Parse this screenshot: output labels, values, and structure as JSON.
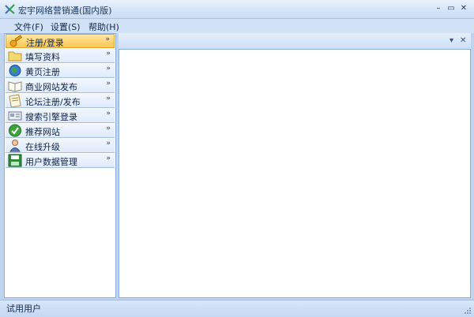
{
  "window": {
    "title": "宏宇网络营销通(国内版)",
    "minimize": "–",
    "restore": "▭",
    "close": "✕"
  },
  "menu": [
    {
      "label": "文件(F)"
    },
    {
      "label": "设置(S)"
    },
    {
      "label": "帮助(H)"
    }
  ],
  "sidebar": {
    "items": [
      {
        "label": "注册/登录",
        "icon": "key-icon",
        "active": true
      },
      {
        "label": "填写资料",
        "icon": "folder-icon"
      },
      {
        "label": "黄页注册",
        "icon": "globe-icon"
      },
      {
        "label": "商业网站发布",
        "icon": "book-icon"
      },
      {
        "label": "论坛注册/发布",
        "icon": "note-icon"
      },
      {
        "label": "搜索引擎登录",
        "icon": "card-icon"
      },
      {
        "label": "推荐网站",
        "icon": "checkmark-icon"
      },
      {
        "label": "在线升级",
        "icon": "person-icon"
      },
      {
        "label": "用户数据管理",
        "icon": "floppy-icon"
      }
    ],
    "chevron": "»"
  },
  "panel": {
    "dropdown": "▾",
    "close": "✕"
  },
  "status": {
    "text": "试用用户"
  },
  "colors": {
    "accent_active": "#fcc84f",
    "frame": "#bfd4ee",
    "border": "#8eaedb"
  }
}
